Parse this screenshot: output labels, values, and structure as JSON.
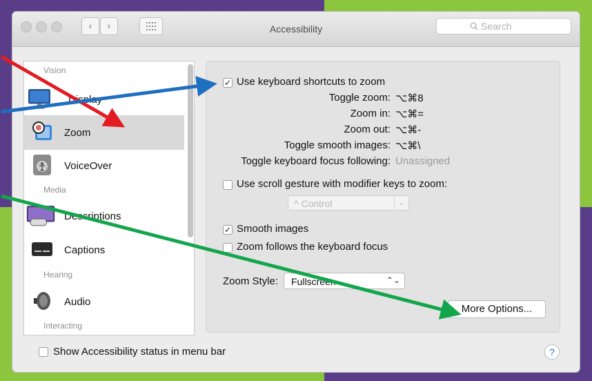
{
  "window": {
    "title": "Accessibility"
  },
  "toolbar": {
    "back": "‹",
    "forward": "›",
    "search_placeholder": "Search"
  },
  "sidebar": {
    "sections": [
      "Vision",
      "Media",
      "Hearing",
      "Interacting"
    ],
    "items": [
      {
        "label": "Display",
        "icon": "display-icon"
      },
      {
        "label": "Zoom",
        "icon": "zoom-icon",
        "selected": true
      },
      {
        "label": "VoiceOver",
        "icon": "voiceover-icon"
      },
      {
        "label": "Descriptions",
        "icon": "descriptions-icon"
      },
      {
        "label": "Captions",
        "icon": "captions-icon"
      },
      {
        "label": "Audio",
        "icon": "audio-icon"
      }
    ]
  },
  "zoom": {
    "use_shortcuts": {
      "label": "Use keyboard shortcuts to zoom",
      "checked": true
    },
    "shortcuts": [
      {
        "label": "Toggle zoom:",
        "value": "⌥⌘8"
      },
      {
        "label": "Zoom in:",
        "value": "⌥⌘="
      },
      {
        "label": "Zoom out:",
        "value": "⌥⌘-"
      },
      {
        "label": "Toggle smooth images:",
        "value": "⌥⌘\\"
      },
      {
        "label": "Toggle keyboard focus following:",
        "value": "Unassigned"
      }
    ],
    "scroll_gesture": {
      "label": "Use scroll gesture with modifier keys to zoom:",
      "checked": false
    },
    "modifier_select": {
      "value": "^ Control"
    },
    "smooth_images": {
      "label": "Smooth images",
      "checked": true
    },
    "follow_focus": {
      "label": "Zoom follows the keyboard focus",
      "checked": false
    },
    "zoom_style": {
      "label": "Zoom Style:",
      "value": "Fullscreen"
    },
    "more_options": "More Options..."
  },
  "footer": {
    "status_label": "Show Accessibility status in menu bar",
    "help": "?"
  },
  "colors": {
    "red_arrow": "#e31b23",
    "blue_arrow": "#1f6fc0",
    "green_arrow": "#13a54b"
  }
}
